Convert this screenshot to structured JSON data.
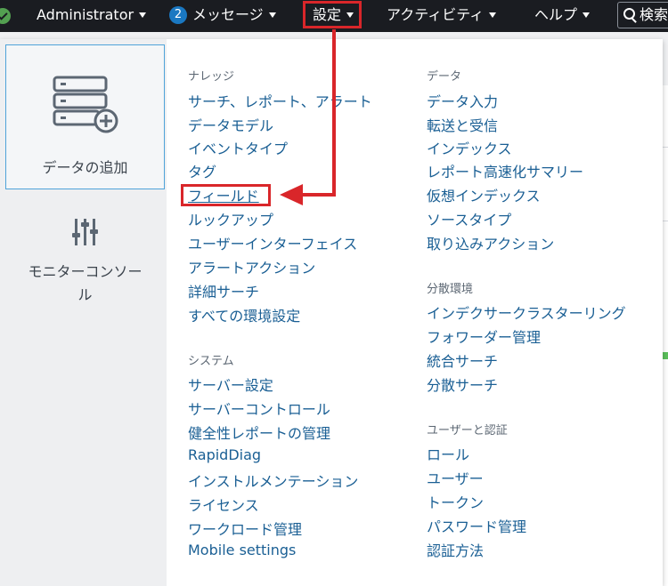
{
  "topbar": {
    "admin_label": "Administrator",
    "messages_count": "2",
    "messages_label": "メッセージ",
    "settings_label": "設定",
    "activity_label": "アクティビティ",
    "help_label": "ヘルプ",
    "search_label": "検索"
  },
  "sidebar": {
    "add_data_label": "データの追加",
    "monitoring_label_line1": "モニターコンソー",
    "monitoring_label_line2": "ル"
  },
  "menu": {
    "knowledge": {
      "heading": "ナレッジ",
      "items": [
        "サーチ、レポート、アラート",
        "データモデル",
        "イベントタイプ",
        "タグ",
        "フィールド",
        "ルックアップ",
        "ユーザーインターフェイス",
        "アラートアクション",
        "詳細サーチ",
        "すべての環境設定"
      ]
    },
    "system": {
      "heading": "システム",
      "items": [
        "サーバー設定",
        "サーバーコントロール",
        "健全性レポートの管理",
        "RapidDiag",
        "インストルメンテーション",
        "ライセンス",
        "ワークロード管理",
        "Mobile settings"
      ]
    },
    "data": {
      "heading": "データ",
      "items": [
        "データ入力",
        "転送と受信",
        "インデックス",
        "レポート高速化サマリー",
        "仮想インデックス",
        "ソースタイプ",
        "取り込みアクション"
      ]
    },
    "distributed": {
      "heading": "分散環境",
      "items": [
        "インデクサークラスターリング",
        "フォワーダー管理",
        "統合サーチ",
        "分散サーチ"
      ]
    },
    "users_auth": {
      "heading": "ユーザーと認証",
      "items": [
        "ロール",
        "ユーザー",
        "トークン",
        "パスワード管理",
        "認証方法"
      ]
    }
  },
  "colors": {
    "topbar_bg": "#1a1c21",
    "link": "#1a5f94",
    "annotation_red": "#d9262a",
    "heading": "#5c6773",
    "sidebar_bg": "#eeeff1"
  }
}
